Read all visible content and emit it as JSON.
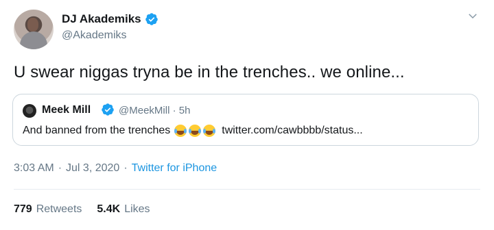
{
  "author": {
    "display_name": "DJ Akademiks",
    "handle": "@Akademiks",
    "avatar_icon": "avatar"
  },
  "tweet_text": "U swear niggas tryna be in the trenches.. we online...",
  "quoted": {
    "display_name": "Meek Mill",
    "handle_time": "@MeekMill · 5h",
    "text_before": "And banned from the trenches",
    "emoji": "face-with-tears-of-joy",
    "link": "twitter.com/cawbbbb/status..."
  },
  "meta": {
    "time": "3:03 AM",
    "separator": "·",
    "date": "Jul 3, 2020",
    "source": "Twitter for iPhone"
  },
  "stats": {
    "retweets_count": "779",
    "retweets_label": "Retweets",
    "likes_count": "5.4K",
    "likes_label": "Likes"
  },
  "colors": {
    "verified_blue": "#1da1f2",
    "link_blue": "#1b95e0",
    "secondary_text": "#657786"
  }
}
